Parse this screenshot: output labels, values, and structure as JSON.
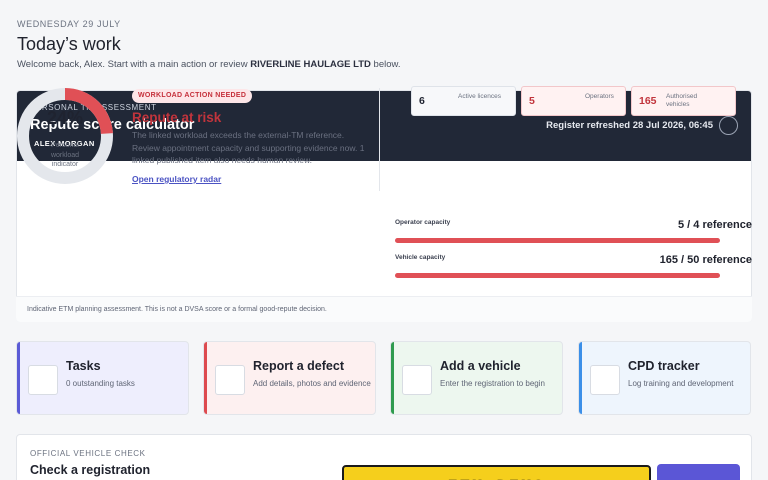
{
  "header": {
    "date": "WEDNESDAY 29 JULY",
    "title": "Today’s work",
    "welcome_prefix": "Welcome back, Alex. Start with a main action or review ",
    "operator_name": "RIVERLINE HAULAGE LTD",
    "welcome_suffix": " below."
  },
  "assessment": {
    "eyebrow": "PERSONAL TM ASSESSMENT",
    "title": "Repute score calculator",
    "person": "ALEX MORGAN",
    "refreshed": "Register refreshed 28 Jul 2026, 06:45",
    "gauge": {
      "percent_label": "24%",
      "percent": 24,
      "caption": "Personal workload indicator",
      "accent_color": "#e05056",
      "track_color": "#e4e7ec"
    },
    "badge": "WORKLOAD ACTION NEEDED",
    "status": "Repute at risk",
    "description": "The linked workload exceeds the external-TM reference. Review appointment capacity and supporting evidence now. 1 linked published item also needs human review.",
    "link": "Open regulatory radar",
    "stats": [
      {
        "value": "6",
        "label": "Active licences"
      },
      {
        "value": "5",
        "label": "Operators"
      },
      {
        "value": "165",
        "label": "Authorised vehicles"
      }
    ],
    "operator_capacity": {
      "label": "Operator capacity",
      "value": "5 / 4 reference",
      "fill": 1.0
    },
    "vehicle_capacity": {
      "label": "Vehicle capacity",
      "value": "165 / 50 reference",
      "fill": 1.0
    },
    "footnote": "Indicative ETM planning assessment. This is not a DVSA score or a formal good-repute decision."
  },
  "actions": [
    {
      "title": "Tasks",
      "subtitle": "0 outstanding tasks",
      "accent": "#5b5bd6",
      "bg": "#eeeefd"
    },
    {
      "title": "Report a defect",
      "subtitle": "Add details, photos and evidence",
      "accent": "#dd4a4f",
      "bg": "#fdf0f0"
    },
    {
      "title": "Add a vehicle",
      "subtitle": "Enter the registration to begin",
      "accent": "#2e9b4e",
      "bg": "#edf7ef"
    },
    {
      "title": "CPD tracker",
      "subtitle": "Log training and development",
      "accent": "#3b8fe8",
      "bg": "#eef5fd"
    }
  ],
  "vehicle_check": {
    "eyebrow": "OFFICIAL VEHICLE CHECK",
    "title": "Check a registration",
    "plate_placeholder": "ETM DEMO"
  }
}
